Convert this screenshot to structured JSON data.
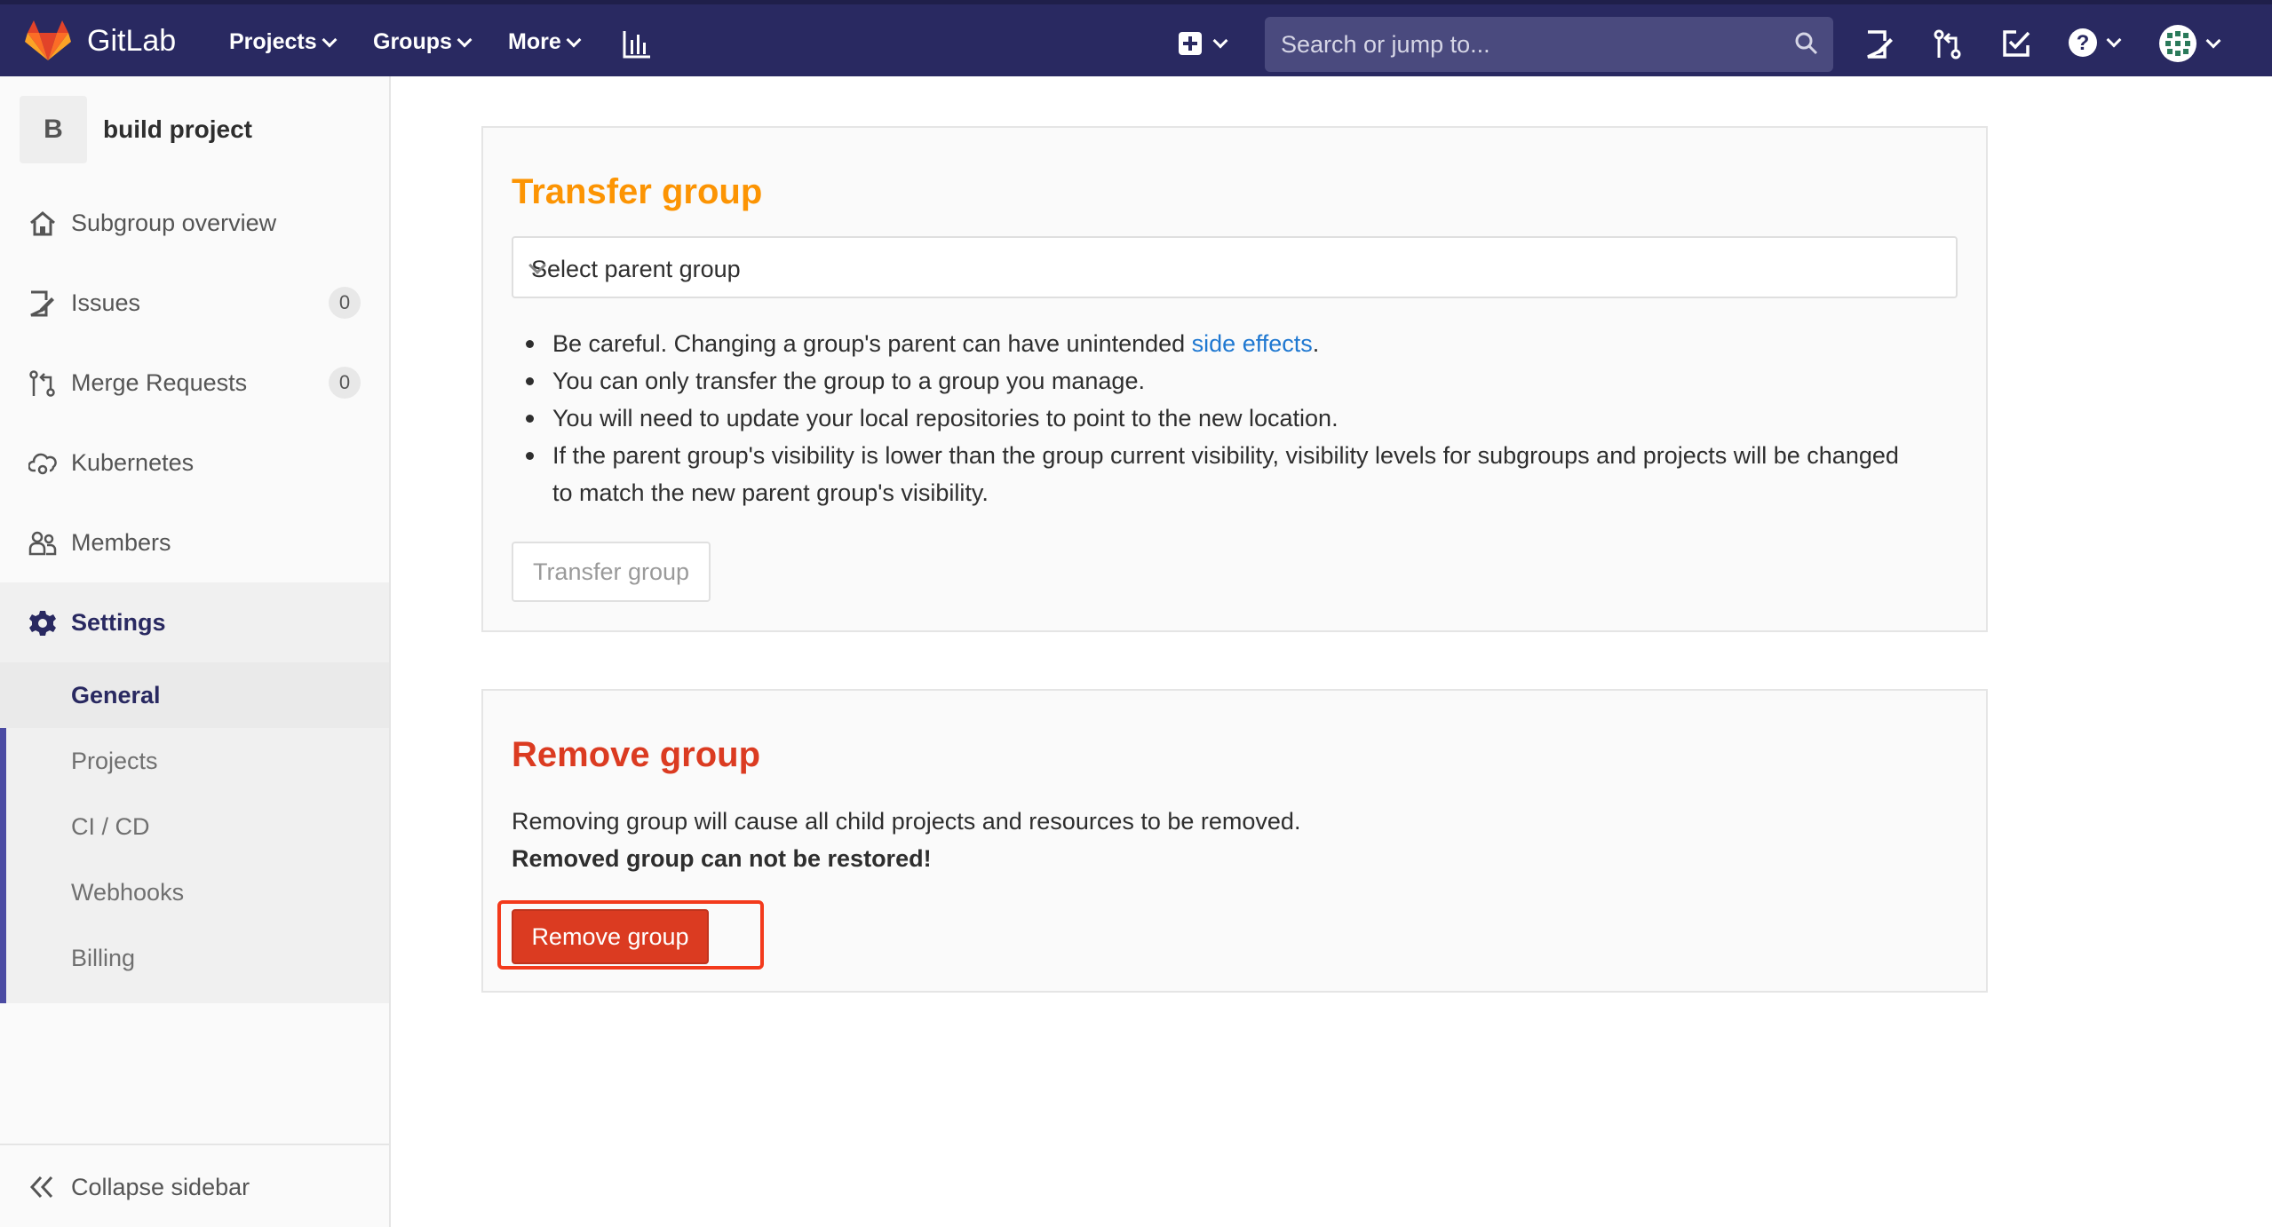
{
  "navbar": {
    "brand": "GitLab",
    "projects_label": "Projects",
    "groups_label": "Groups",
    "more_label": "More",
    "search_placeholder": "Search or jump to..."
  },
  "sidebar": {
    "avatar_letter": "B",
    "project_name": "build project",
    "items": [
      {
        "label": "Subgroup overview",
        "icon": "home-icon"
      },
      {
        "label": "Issues",
        "badge": "0",
        "icon": "issues-icon"
      },
      {
        "label": "Merge Requests",
        "badge": "0",
        "icon": "merge-request-icon"
      },
      {
        "label": "Kubernetes",
        "icon": "cloud-gear-icon"
      },
      {
        "label": "Members",
        "icon": "users-icon"
      },
      {
        "label": "Settings",
        "icon": "gear-icon"
      }
    ],
    "settings_sub": [
      "General",
      "Projects",
      "CI / CD",
      "Webhooks",
      "Billing"
    ],
    "collapse_label": "Collapse sidebar"
  },
  "transfer": {
    "title": "Transfer group",
    "select_value": "Select parent group",
    "bullet1_prefix": "Be careful. Changing a group's parent can have unintended ",
    "bullet1_link": "side effects",
    "bullet1_suffix": ".",
    "bullet2": "You can only transfer the group to a group you manage.",
    "bullet3": "You will need to update your local repositories to point to the new location.",
    "bullet4": "If the parent group's visibility is lower than the group current visibility, visibility levels for subgroups and projects will be changed to match the new parent group's visibility.",
    "button": "Transfer group"
  },
  "remove": {
    "title": "Remove group",
    "warning": "Removing group will cause all child projects and resources to be removed.",
    "warning_bold": "Removed group can not be restored!",
    "button": "Remove group"
  },
  "colors": {
    "navbar": "#292961",
    "transfer_title": "#fc9403",
    "remove_title": "#db3b21",
    "remove_button": "#db3b21",
    "highlight": "#f33a1c",
    "link": "#1f78d1"
  }
}
